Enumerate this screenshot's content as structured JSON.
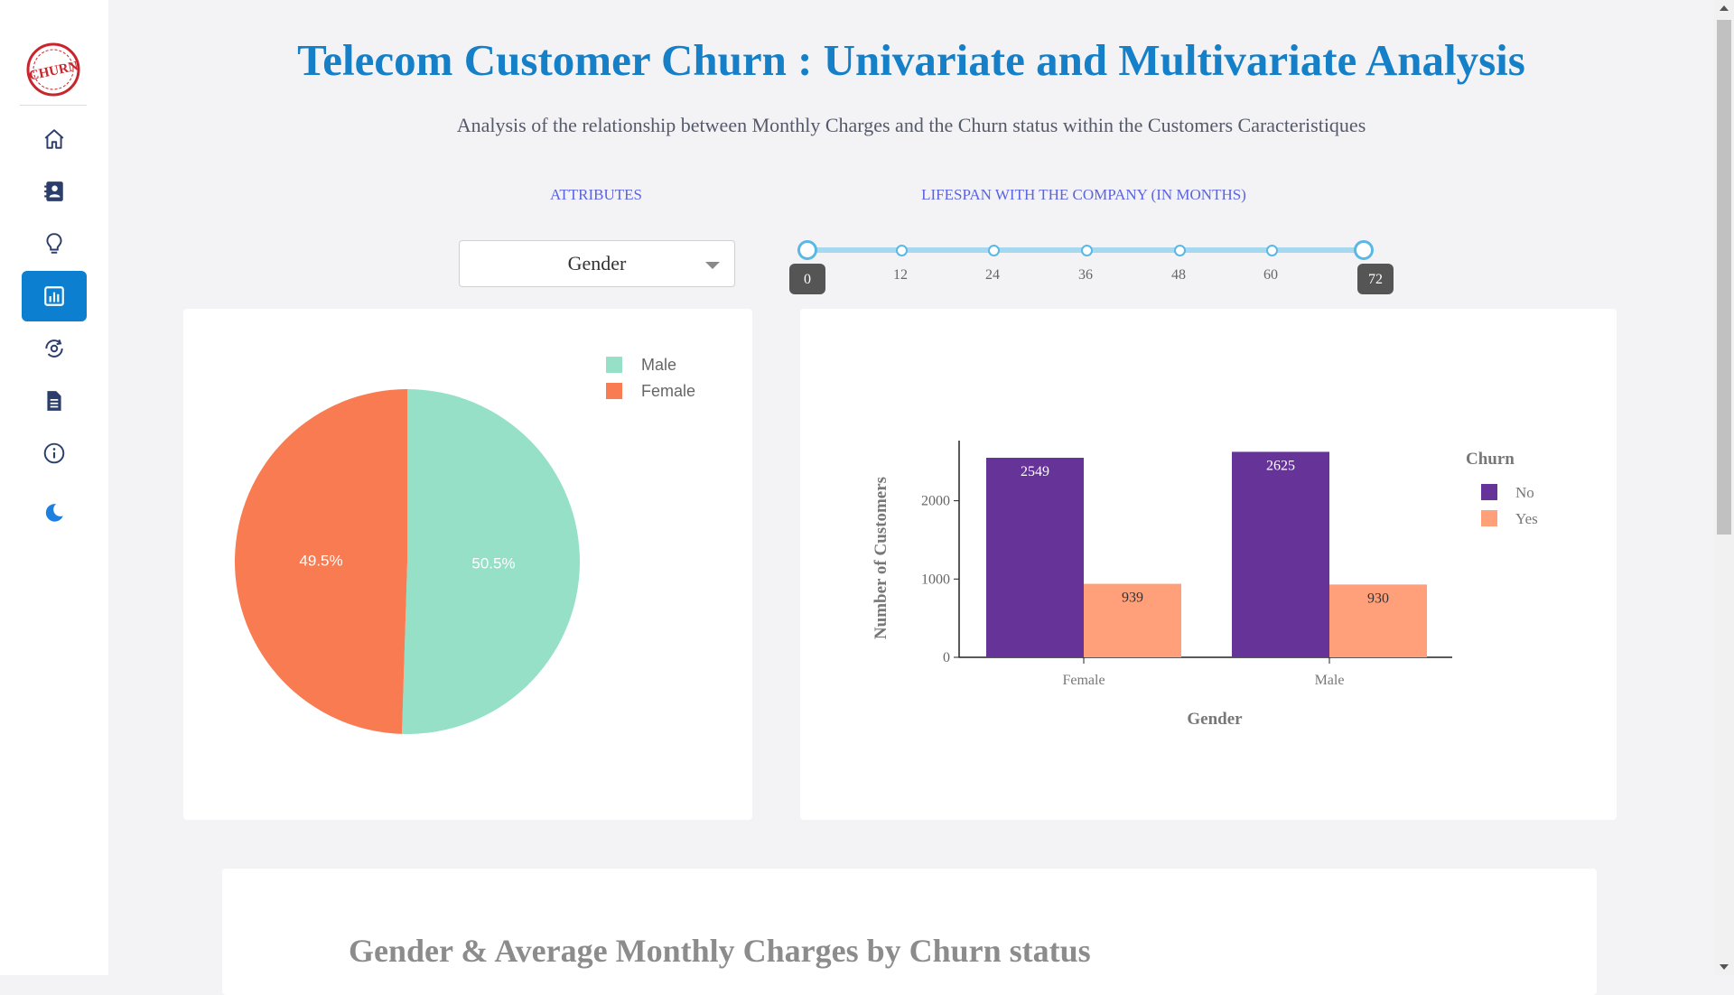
{
  "app": {
    "title": "Telecom Customer Churn : Univariate and Multivariate Analysis",
    "subtitle": "Analysis of the relationship between Monthly Charges and the Churn status within the Customers Caracteristiques",
    "logo_text": "CHURN"
  },
  "sidebar": {
    "items": [
      {
        "name": "home",
        "icon": "home-icon",
        "active": false
      },
      {
        "name": "contacts",
        "icon": "contact-book-icon",
        "active": false
      },
      {
        "name": "insights",
        "icon": "lightbulb-icon",
        "active": false
      },
      {
        "name": "analysis",
        "icon": "bar-chart-icon",
        "active": true
      },
      {
        "name": "prediction",
        "icon": "refresh-eye-icon",
        "active": false
      },
      {
        "name": "report",
        "icon": "document-icon",
        "active": false
      },
      {
        "name": "about",
        "icon": "info-icon",
        "active": false
      },
      {
        "name": "theme",
        "icon": "moon-icon",
        "active": false
      }
    ],
    "active_color": "#0c7fd1"
  },
  "controls": {
    "attributes_label": "ATTRIBUTES",
    "attribute_selected": "Gender",
    "lifespan_label": "LIFESPAN WITH THE COMPANY (IN MONTHS)",
    "slider": {
      "min": 0,
      "max": 72,
      "value_low": 0,
      "value_high": 72,
      "marks": [
        0,
        12,
        24,
        36,
        48,
        60,
        72
      ],
      "low_label": "0",
      "high_label": "72"
    }
  },
  "pie_chart": {
    "type": "pie",
    "slices": [
      {
        "label": "Male",
        "percent": 50.5,
        "percent_label": "50.5%",
        "color": "#96e0c8"
      },
      {
        "label": "Female",
        "percent": 49.5,
        "percent_label": "49.5%",
        "color": "#f87b52"
      }
    ]
  },
  "bar_chart": {
    "type": "bar",
    "categories": [
      "Female",
      "Male"
    ],
    "series": [
      {
        "name": "No",
        "values": [
          2549,
          2625
        ],
        "labels": [
          "2549",
          "2625"
        ],
        "color": "#663399"
      },
      {
        "name": "Yes",
        "values": [
          939,
          930
        ],
        "labels": [
          "939",
          "930"
        ],
        "color": "#ffa07a"
      }
    ],
    "xlabel": "Gender",
    "ylabel": "Number of Customers",
    "legend_title": "Churn",
    "ylim": [
      0,
      2800
    ],
    "yticks": [
      0,
      1000,
      2000
    ],
    "ytick_labels": [
      "0",
      "1000",
      "2000"
    ]
  },
  "chart_data": [
    {
      "type": "pie",
      "categories": [
        "Male",
        "Female"
      ],
      "values": [
        50.5,
        49.5
      ],
      "title": "",
      "legend": [
        "Male",
        "Female"
      ],
      "legend_position": "top-right"
    },
    {
      "type": "bar",
      "categories": [
        "Female",
        "Male"
      ],
      "series": [
        {
          "name": "No",
          "values": [
            2549,
            2625
          ]
        },
        {
          "name": "Yes",
          "values": [
            939,
            930
          ]
        }
      ],
      "title": "",
      "xlabel": "Gender",
      "ylabel": "Number of Customers",
      "legend_title": "Churn",
      "ylim": [
        0,
        2800
      ],
      "grid": false,
      "legend_position": "top-right"
    }
  ],
  "bottom_section": {
    "title": "Gender & Average Monthly Charges by Churn status"
  }
}
